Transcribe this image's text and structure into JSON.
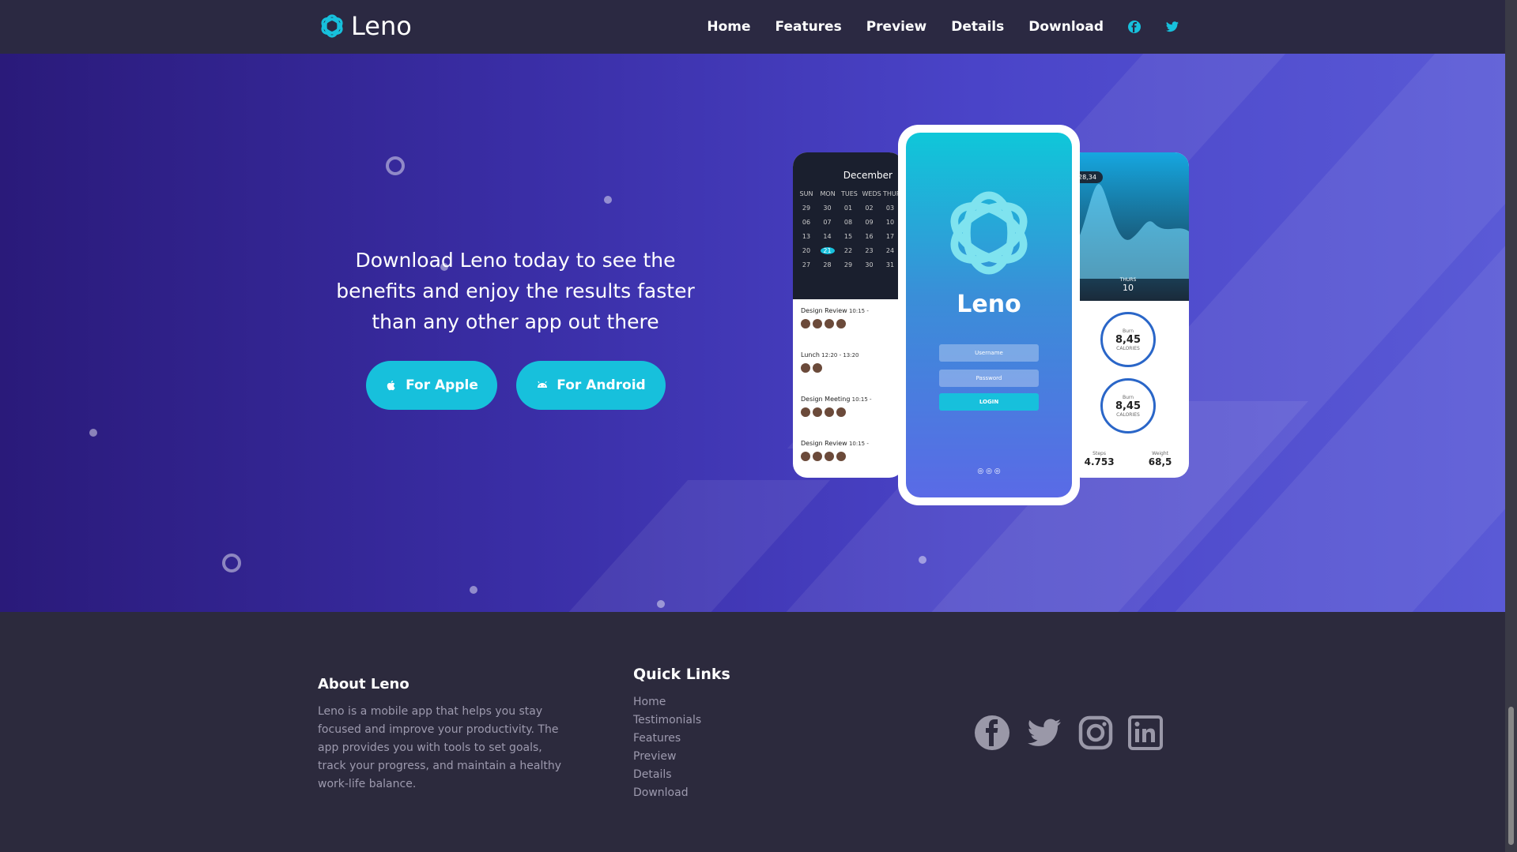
{
  "nav": {
    "brand": "Leno",
    "links": [
      "Home",
      "Features",
      "Preview",
      "Details",
      "Download"
    ],
    "icons": [
      "facebook-icon",
      "twitter-icon"
    ],
    "accent": "#17c0dc"
  },
  "hero": {
    "text": "Download Leno today to see the benefits and enjoy the results faster than any other app out there",
    "apple_label": "For Apple",
    "android_label": "For Android",
    "button_color": "#17c0dc"
  },
  "phones": {
    "calendar": {
      "month": "December",
      "days": [
        "SUN",
        "MON",
        "TUES",
        "WEDS",
        "THURS"
      ],
      "weeks": [
        [
          "29",
          "30",
          "01",
          "02",
          "03"
        ],
        [
          "06",
          "07",
          "08",
          "09",
          "10"
        ],
        [
          "13",
          "14",
          "15",
          "16",
          "17"
        ],
        [
          "20",
          "21",
          "22",
          "23",
          "24"
        ],
        [
          "27",
          "28",
          "29",
          "30",
          "31"
        ]
      ],
      "events": [
        {
          "title": "Design Review",
          "time": "10:15 -"
        },
        {
          "title": "Lunch",
          "time": "12:20 - 13:20"
        },
        {
          "title": "Design Meeting",
          "time": "10:15 -"
        },
        {
          "title": "Design Review",
          "time": "10:15 -"
        }
      ]
    },
    "login": {
      "brand": "Leno",
      "username": "Username",
      "password": "Password",
      "button": "LOGIN"
    },
    "stats": {
      "temp": "28,34",
      "day_label": "THURS",
      "day": "10",
      "gauge_value": "8,45",
      "gauge_label_top": "Burn",
      "gauge_label_bottom": "CALORIES",
      "steps_label": "Steps",
      "steps": "4.753",
      "weight_label": "Weight",
      "weight": "68,5"
    }
  },
  "footer": {
    "about_title": "About Leno",
    "about_text": "Leno is a mobile app that helps you stay focused and improve your productivity. The app provides you with tools to set goals, track your progress, and maintain a healthy work-life balance.",
    "quick_links_title": "Quick Links",
    "quick_links": [
      "Home",
      "Testimonials",
      "Features",
      "Preview",
      "Details",
      "Download"
    ],
    "social_icons": [
      "facebook-icon",
      "twitter-icon",
      "instagram-icon",
      "linkedin-icon"
    ]
  }
}
